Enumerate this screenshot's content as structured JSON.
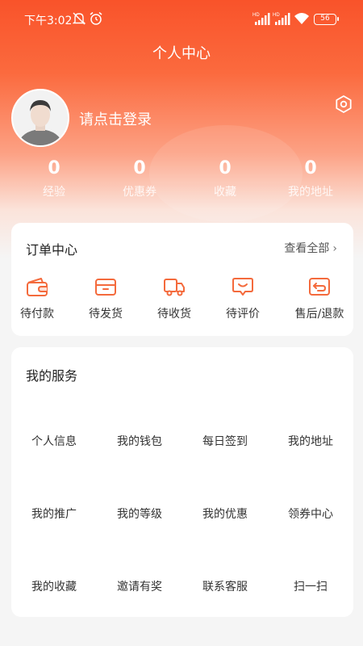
{
  "status_bar": {
    "time": "下午3:02",
    "battery": "56"
  },
  "header": {
    "title": "个人中心"
  },
  "profile": {
    "login_text": "请点击登录"
  },
  "stats": [
    {
      "value": "0",
      "label": "经验"
    },
    {
      "value": "0",
      "label": "优惠券"
    },
    {
      "value": "0",
      "label": "收藏"
    },
    {
      "value": "0",
      "label": "我的地址"
    }
  ],
  "orders": {
    "title": "订单中心",
    "view_all": "查看全部",
    "items": [
      {
        "label": "待付款",
        "icon": "wallet-icon"
      },
      {
        "label": "待发货",
        "icon": "package-icon"
      },
      {
        "label": "待收货",
        "icon": "truck-icon"
      },
      {
        "label": "待评价",
        "icon": "review-icon"
      },
      {
        "label": "售后/退款",
        "icon": "return-icon"
      }
    ]
  },
  "services": {
    "title": "我的服务",
    "items": [
      "个人信息",
      "我的钱包",
      "每日签到",
      "我的地址",
      "我的推广",
      "我的等级",
      "我的优惠",
      "领券中心",
      "我的收藏",
      "邀请有奖",
      "联系客服",
      "扫一扫"
    ]
  },
  "colors": {
    "accent": "#f9532a",
    "icon": "#f46a3c"
  }
}
